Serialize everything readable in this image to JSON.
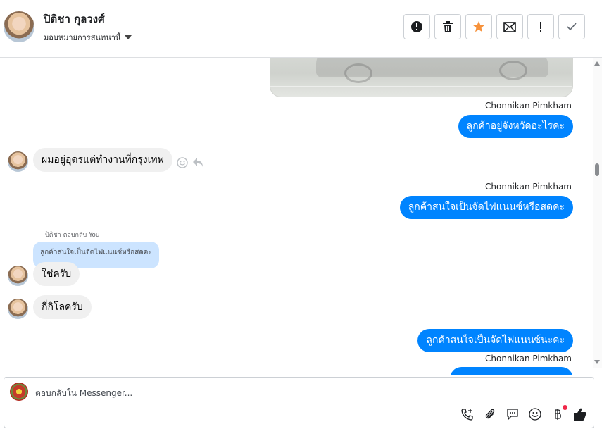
{
  "header": {
    "contact_name": "ปิดิชา กุลวงศ์",
    "assign_label": "มอบหมายการสนทนานี้",
    "toolbar": [
      {
        "icon": "alert-circle-icon",
        "title": "spam"
      },
      {
        "icon": "trash-icon",
        "title": "delete"
      },
      {
        "icon": "star-icon",
        "title": "star"
      },
      {
        "icon": "mark-unread-icon",
        "title": "unread"
      },
      {
        "icon": "exclamation-icon",
        "title": "follow-up"
      },
      {
        "icon": "check-icon",
        "title": "done"
      }
    ],
    "star_color": "#f7923b"
  },
  "messages": {
    "out_1": {
      "sender": "Chonnikan Pimkham",
      "text": "ลูกค้าอยู่จังหวัดอะไรคะ"
    },
    "in_1": {
      "text": "ผมอยู่อุดรแต่ทำงานที่กรุงเทพ"
    },
    "out_2": {
      "sender": "Chonnikan Pimkham",
      "text": "ลูกค้าสนใจเป็นจัดไฟแนนซ์หรือสดคะ"
    },
    "reply": {
      "label": "ปิดิชา ตอบกลับ You",
      "quoted": "ลูกค้าสนใจเป็นจัดไฟแนนซ์หรือสดคะ"
    },
    "in_2": {
      "text": "ใช่ครับ"
    },
    "in_3": {
      "text": "กี่กิโลครับ"
    },
    "out_3": {
      "text": "ลูกค้าสนใจเป็นจัดไฟแนนซ์นะคะ"
    },
    "out_4": {
      "sender": "Chonnikan Pimkham"
    }
  },
  "composer": {
    "placeholder": "ตอบกลับใน Messenger...",
    "tools": [
      "phone-plus-icon",
      "attach-icon",
      "saved-reply-icon",
      "emoji-icon",
      "baht-icon",
      "like-icon"
    ]
  },
  "colors": {
    "outgoing": "#0084ff",
    "incoming": "#f0f0f0",
    "quoted": "#cce4ff"
  }
}
